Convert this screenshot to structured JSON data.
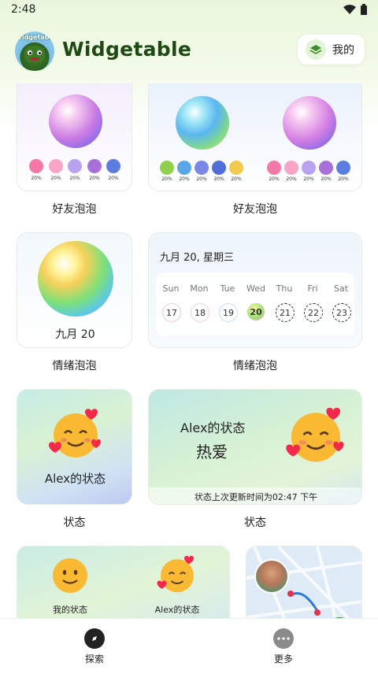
{
  "status_bar": {
    "time": "2:48"
  },
  "header": {
    "logo_text": "Widgetable",
    "app_name": "Widgetable",
    "mine_label": "我的"
  },
  "widgets": {
    "friend_bubble_small": {
      "caption": "好友泡泡",
      "percents": [
        "20%",
        "20%",
        "20%",
        "20%",
        "20%"
      ]
    },
    "friend_bubble_wide": {
      "caption": "好友泡泡",
      "percents_left": [
        "20%",
        "20%",
        "20%",
        "20%",
        "20%"
      ],
      "percents_right": [
        "20%",
        "20%",
        "20%",
        "20%",
        "20%"
      ]
    },
    "mood_bubble_small": {
      "date": "九月 20",
      "caption": "情绪泡泡"
    },
    "mood_bubble_wide": {
      "date": "九月 20, 星期三",
      "days": [
        "Sun",
        "Mon",
        "Tue",
        "Wed",
        "Thu",
        "Fri",
        "Sat"
      ],
      "nums": [
        "17",
        "18",
        "19",
        "20",
        "21",
        "22",
        "23"
      ],
      "caption": "情绪泡泡"
    },
    "status_small": {
      "name": "Alex的状态",
      "caption": "状态"
    },
    "status_wide": {
      "name": "Alex的状态",
      "mood": "热爱",
      "updated": "状态上次更新时间为02:47 下午",
      "caption": "状态"
    },
    "status_pair": {
      "mine": "我的状态",
      "alex": "Alex的状态"
    }
  },
  "bottom_nav": {
    "explore": "探索",
    "more": "更多"
  },
  "colors": {
    "brand_green": "#1e4a12",
    "accent_light": "#e3f3d6"
  }
}
